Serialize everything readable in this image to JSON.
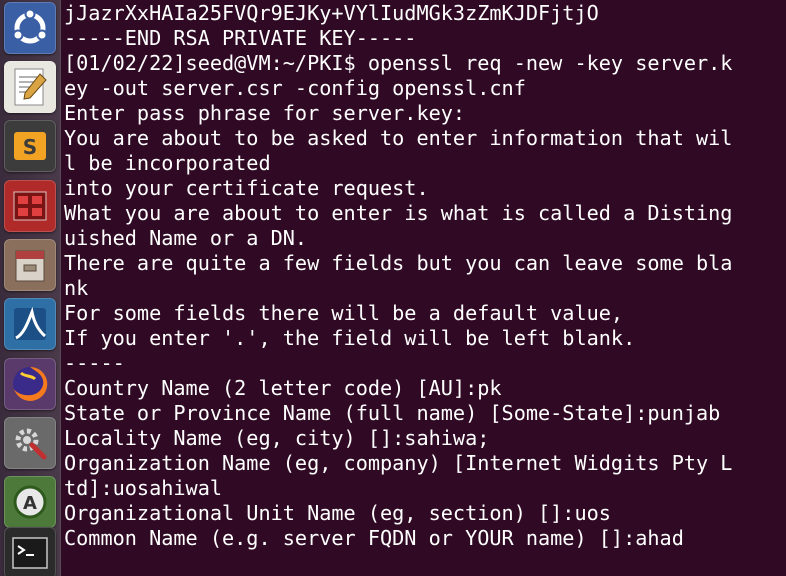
{
  "launcher": {
    "items": [
      {
        "icon": "ubuntu-dash-icon",
        "bg": "#3b5fa4"
      },
      {
        "icon": "text-editor-icon",
        "bg": "#e8e8e0"
      },
      {
        "icon": "sublime-text-icon",
        "bg": "#3c3c3c"
      },
      {
        "icon": "bless-hex-editor-icon",
        "bg": "#b12a2a"
      },
      {
        "icon": "files-icon",
        "bg": "#8a6f5c"
      },
      {
        "icon": "wireshark-icon",
        "bg": "#2e6fa6"
      },
      {
        "icon": "firefox-icon",
        "bg": "#5a3a6a"
      },
      {
        "icon": "system-settings-icon",
        "bg": "#6a6a6a"
      },
      {
        "icon": "software-updater-icon",
        "bg": "#4d7a3a"
      },
      {
        "icon": "terminal-icon",
        "bg": "#2b2b2b"
      }
    ]
  },
  "terminal": {
    "lines": [
      "jJazrXxHAIa25FVQr9EJKy+VYlIudMGk3zZmKJDFjtjO",
      "-----END RSA PRIVATE KEY-----",
      "[01/02/22]seed@VM:~/PKI$ openssl req -new -key server.k",
      "ey -out server.csr -config openssl.cnf",
      "Enter pass phrase for server.key:",
      "You are about to be asked to enter information that wil",
      "l be incorporated",
      "into your certificate request.",
      "What you are about to enter is what is called a Disting",
      "uished Name or a DN.",
      "There are quite a few fields but you can leave some bla",
      "nk",
      "For some fields there will be a default value,",
      "If you enter '.', the field will be left blank.",
      "-----",
      "Country Name (2 letter code) [AU]:pk",
      "State or Province Name (full name) [Some-State]:punjab",
      "Locality Name (eg, city) []:sahiwa;",
      "Organization Name (eg, company) [Internet Widgits Pty L",
      "td]:uosahiwal",
      "Organizational Unit Name (eg, section) []:uos",
      "Common Name (e.g. server FQDN or YOUR name) []:ahad"
    ]
  }
}
